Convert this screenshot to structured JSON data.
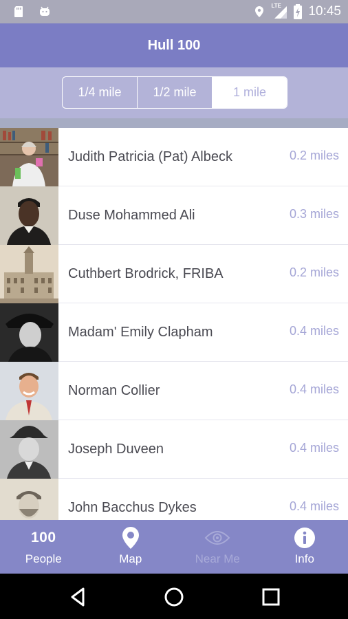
{
  "status_bar": {
    "time": "10:45",
    "network": "LTE",
    "icons": [
      "sd-card-icon",
      "android-icon",
      "location-icon",
      "signal-icon",
      "battery-icon"
    ]
  },
  "app": {
    "title": "Hull 100",
    "accent": "#7b7dc4"
  },
  "distance_filter": {
    "options": [
      "1/4 mile",
      "1/2 mile",
      "1 mile"
    ],
    "selected": "1 mile"
  },
  "people": [
    {
      "name": "Judith Patricia (Pat) Albeck",
      "distance": "0.2 miles"
    },
    {
      "name": "Duse Mohammed Ali",
      "distance": "0.3 miles"
    },
    {
      "name": "Cuthbert Brodrick, FRIBA",
      "distance": "0.2 miles"
    },
    {
      "name": "Madam' Emily Clapham",
      "distance": "0.4 miles"
    },
    {
      "name": "Norman Collier",
      "distance": "0.4 miles"
    },
    {
      "name": "Joseph Duveen",
      "distance": "0.4 miles"
    },
    {
      "name": "John Bacchus Dykes",
      "distance": "0.4 miles"
    }
  ],
  "bottom_nav": {
    "people_badge": "100",
    "items": [
      {
        "label": "People",
        "icon": "hundred-icon",
        "enabled": true
      },
      {
        "label": "Map",
        "icon": "map-pin-icon",
        "enabled": true
      },
      {
        "label": "Near Me",
        "icon": "eye-icon",
        "enabled": false
      },
      {
        "label": "Info",
        "icon": "info-icon",
        "enabled": true
      }
    ]
  },
  "system_nav": {
    "icons": [
      "back-icon",
      "home-icon",
      "recents-icon"
    ]
  }
}
